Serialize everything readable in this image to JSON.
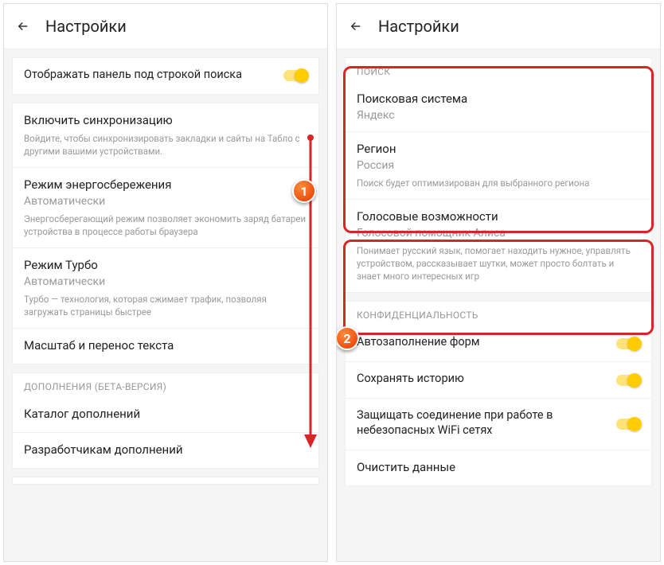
{
  "left": {
    "header": {
      "title": "Настройки"
    },
    "panel_toggle": {
      "label": "Отображать панель под строкой поиска"
    },
    "sync": {
      "title": "Включить синхронизацию",
      "desc": "Войдите, чтобы синхронизировать закладки и сайты на Табло с другими вашими устройствами."
    },
    "energy": {
      "title": "Режим энергосбережения",
      "value": "Автоматически",
      "desc": "Энергосберегающий режим позволяет экономить заряд батареи устройства в процессе работы браузера"
    },
    "turbo": {
      "title": "Режим Турбо",
      "value": "Автоматически",
      "desc": "Турбо — технология, которая сжимает трафик, позволяя загружать страницы быстрее"
    },
    "scale": {
      "title": "Масштаб и перенос текста"
    },
    "addons_header": "ДОПОЛНЕНИЯ (БЕТА-ВЕРСИЯ)",
    "catalog": {
      "title": "Каталог дополнений"
    },
    "devs": {
      "title": "Разработчикам дополнений"
    }
  },
  "right": {
    "header": {
      "title": "Настройки"
    },
    "search_header": "ПОИСК",
    "engine": {
      "title": "Поисковая система",
      "value": "Яндекс"
    },
    "region": {
      "title": "Регион",
      "value": "Россия",
      "desc": "Поиск будет оптимизирован для выбранного региона"
    },
    "voice": {
      "title": "Голосовые возможности",
      "value": "Голосовой помощник Алиса",
      "desc": "Понимает русский язык, помогает находить нужное, управлять устройством, рассказывает шутки, может просто болтать и знает много интересных игр"
    },
    "privacy_header": "КОНФИДЕНЦИАЛЬНОСТЬ",
    "autofill": {
      "title": "Автозаполнение форм"
    },
    "history": {
      "title": "Сохранять историю"
    },
    "wifi": {
      "title": "Защищать соединение при работе в небезопасных WiFi сетях"
    },
    "clear": {
      "title": "Очистить данные"
    }
  },
  "markers": {
    "m1": "1",
    "m2": "2"
  }
}
